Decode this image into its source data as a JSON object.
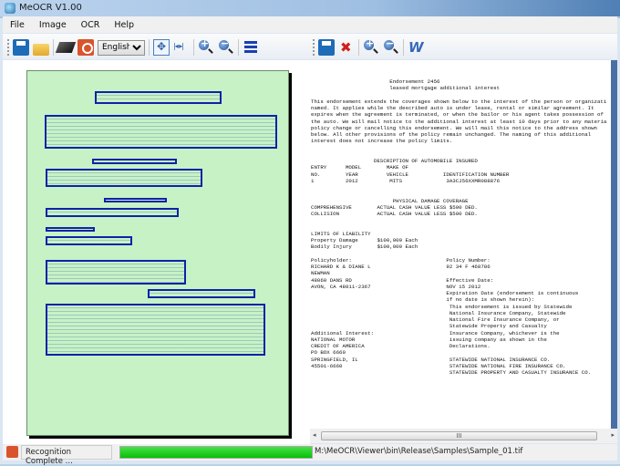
{
  "window": {
    "title": "MeOCR V1.00"
  },
  "menu": [
    "File",
    "Image",
    "OCR",
    "Help"
  ],
  "toolbar": {
    "language": "English"
  },
  "ocr_lines": [
    "                         Endorsement 2456",
    "                         leased mortgage additional interest",
    "",
    "This endorsement extends the coverages shown below to the interest of the person or organizati",
    "named. It applies while the described auto is under lease, rental or similar agreement. It",
    "expires when the agreement is terminated, or when the bailor or his agent takes possession of",
    "the auto. We will mail notice to the additional interest at least 10 days prior to any materia",
    "policy change or cancelling this endorsement. We will mail this notice to the address shown",
    "below. All other provisions of the policy remain unchanged. The naming of this additional",
    "interest does not increase the policy limits.",
    "",
    "",
    "                    DESCRIPTION OF AUTOMOBILE INSURED",
    "ENTRY      MODEL        MAKE OF",
    "NO.        YEAR         VEHICLE           IDENTIFICATION NUMBER",
    "1          2012          MITS              3A3CJ56XXMR088876",
    "",
    "",
    "                          PHYSICAL DAMAGE COVERAGE",
    "COMPREHENSIVE        ACTUAL CASH VALUE LESS $500 DED.",
    "COLLISION            ACTUAL CASH VALUE LESS $500 DED.",
    "",
    "",
    "LIMITS OF LIABILITY",
    "Property Damage      $100,000 Each",
    "Bodily Injury        $100,000 Each",
    "",
    "Policyholder:                              Policy Number:",
    "RICHARD K & DIANE L                        92 34 F 468786",
    "NEWMAN",
    "48060 DANS RD                              Effective Date:",
    "AVON, CA 48011-2367                        NOV 15 2012",
    "                                           Expiration Date (endorsement is continuous",
    "                                           if no date is shown herein):",
    "                                            This endorsement is issued by Statewide",
    "                                            National Insurance Company, Statewide",
    "                                            National Fire Insurance Company, or",
    "                                            Statewide Property and Casualty",
    "Additional Interest:                        Insurance Company, whichever is the",
    "NATIONAL MOTOR                              issuing company as shown in the",
    "CREDIT OF AMERICA                           Declarations.",
    "PO BOX 6660",
    "SPRINGFIELD, IL                             STATEWIDE NATIONAL INSURANCE CO.",
    "45501-6660                                  STATEWIDE NATIONAL FIRE INSURANCE CO.",
    "                                            STATEWIDE PROPERTY AND CASUALTY INSURANCE CO."
  ],
  "scroll": {
    "thumb_grip": "III"
  },
  "status": {
    "message": "Recognition Complete ...",
    "progress_percent": 100,
    "file_path": "M:\\MeOCR\\Viewer\\bin\\Release\\Samples\\Sample_01.tif"
  }
}
